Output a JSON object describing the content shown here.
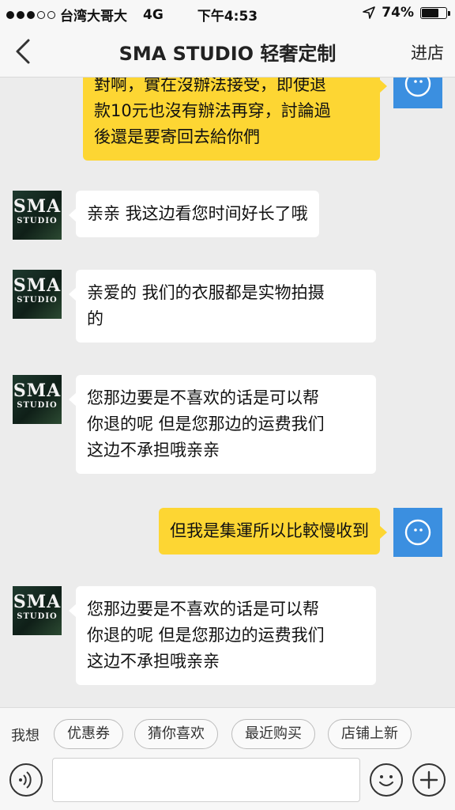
{
  "status_bar": {
    "carrier": "台湾大哥大",
    "network": "4G",
    "time": "下午4:53",
    "battery": "74%",
    "battery_level": 0.74
  },
  "nav": {
    "title": "SMA STUDIO 轻奢定制",
    "store_label": "进店"
  },
  "store_avatar": {
    "line1": "SMA",
    "line2": "STUDIO"
  },
  "messages": [
    {
      "from": "me",
      "lines": [
        "對啊，實在沒辦法接受，即使退",
        "款10元也沒有辦法再穿，討論過",
        "後還是要寄回去給你們"
      ]
    },
    {
      "from": "store",
      "lines": [
        "亲亲 我这边看您时间好长了哦"
      ]
    },
    {
      "from": "store",
      "lines": [
        "亲爱的 我们的衣服都是实物拍摄",
        "的"
      ]
    },
    {
      "from": "store",
      "lines": [
        "您那边要是不喜欢的话是可以帮",
        "你退的呢 但是您那边的运费我们",
        "这边不承担哦亲亲"
      ]
    },
    {
      "from": "me",
      "lines": [
        "但我是集運所以比較慢收到"
      ]
    },
    {
      "from": "store",
      "lines": [
        "您那边要是不喜欢的话是可以帮",
        "你退的呢 但是您那边的运费我们",
        "这边不承担哦亲亲"
      ]
    }
  ],
  "quick_bar": {
    "label": "我想",
    "chips": [
      "优惠券",
      "猜你喜欢",
      "最近购买",
      "店铺上新"
    ]
  },
  "colors": {
    "out_bubble": "#fdd633",
    "in_bubble": "#ffffff",
    "user_avatar": "#3b8fe0"
  }
}
